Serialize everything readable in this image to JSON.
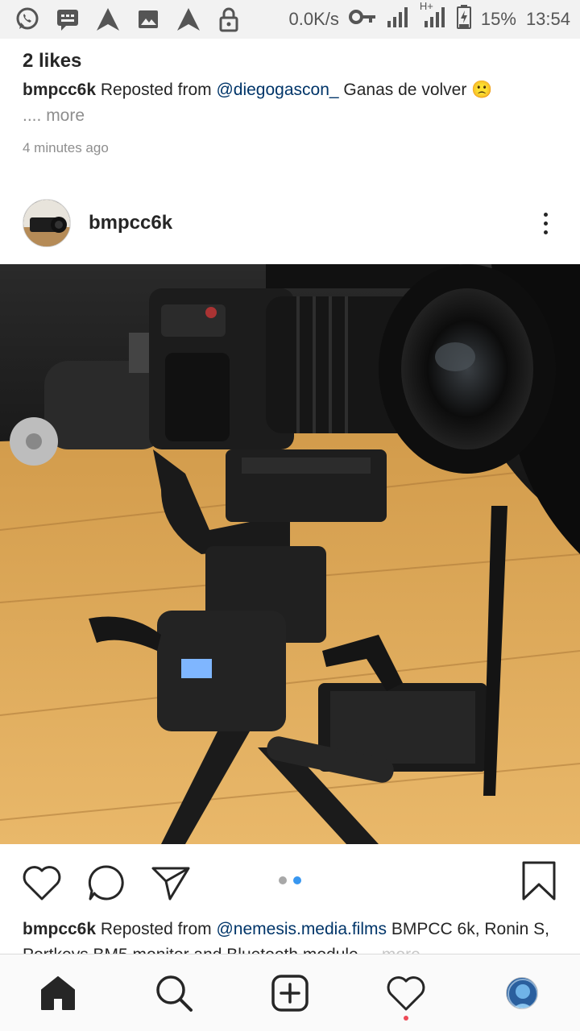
{
  "status_bar": {
    "net_speed": "0.0K/s",
    "network_type": "H+",
    "battery": "15%",
    "time": "13:54",
    "icons": [
      "whatsapp-icon",
      "message-icon",
      "upload-icon",
      "gallery-icon",
      "upload-icon",
      "lock-icon",
      "vpn-key-icon",
      "signal-icon",
      "signal-icon",
      "battery-icon"
    ]
  },
  "previous_post": {
    "likes": "2 likes",
    "username": "bmpcc6k",
    "reposted_from": "Reposted from",
    "mention": "@diegogascon_",
    "caption_text": "Ganas de volver 🙁",
    "ellipsis": "....",
    "more": "more",
    "time_ago": "4 minutes ago"
  },
  "post": {
    "username": "bmpcc6k",
    "photo_icon": "camera-photo",
    "carousel": {
      "count": 2,
      "active_index": 1
    },
    "caption": {
      "username": "bmpcc6k",
      "reposted_from": "Reposted from",
      "mention": "@nemesis.media.films",
      "text": "BMPCC 6k, Ronin S, Portkeys BM5 monitor and Bluetooth module ...",
      "more": "more"
    }
  },
  "colors": {
    "accent_blue": "#3897f0",
    "mention": "#003569",
    "notification_red": "#ed4956"
  },
  "bottom_nav": {
    "items": [
      "home-icon",
      "search-icon",
      "new-post-icon",
      "activity-heart-icon",
      "profile-icon"
    ]
  }
}
